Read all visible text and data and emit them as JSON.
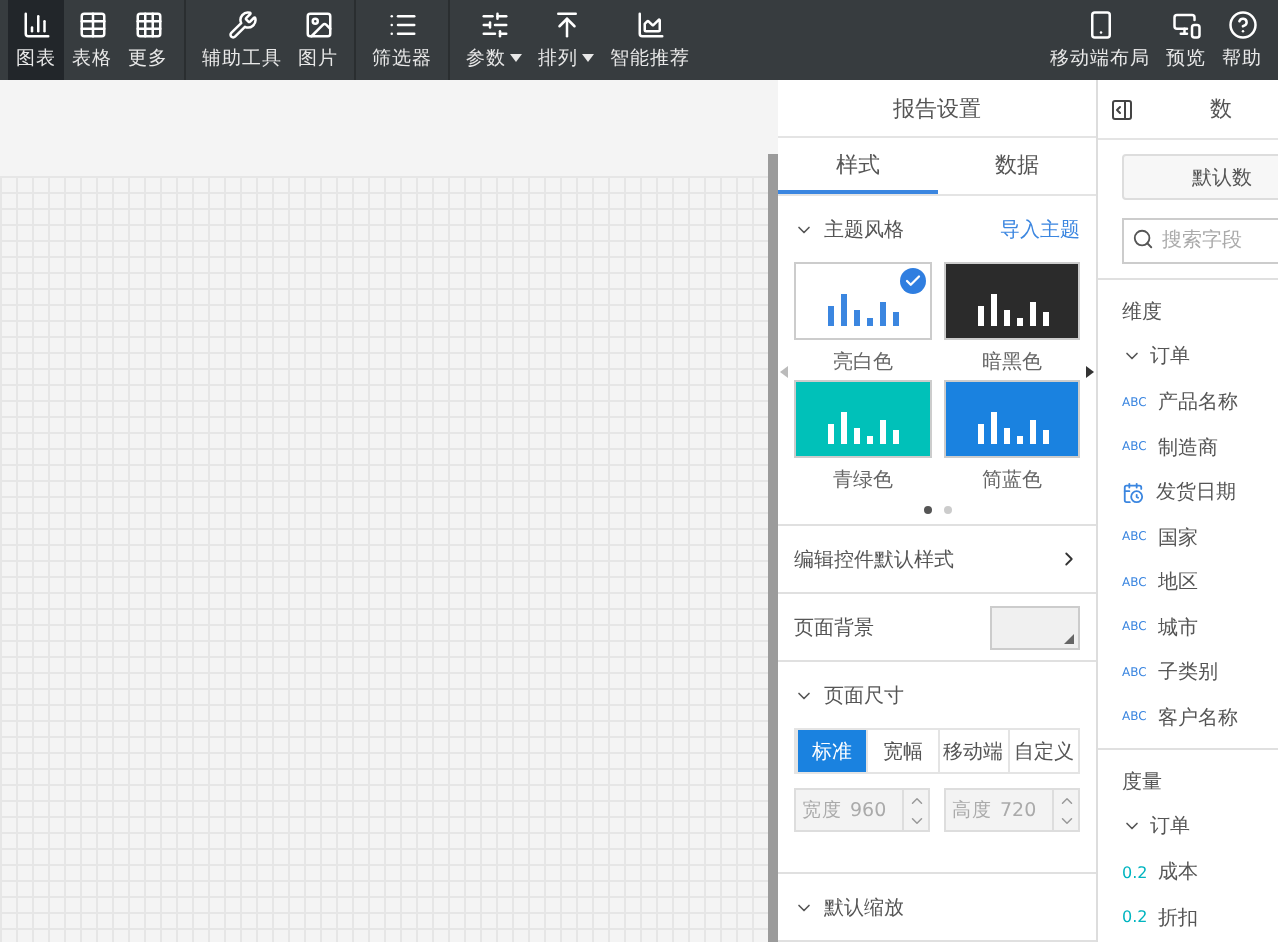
{
  "toolbar": {
    "groups": [
      [
        {
          "label": "图表",
          "selected": true,
          "menu": false
        },
        {
          "label": "表格",
          "selected": false,
          "menu": false
        },
        {
          "label": "更多",
          "selected": false,
          "menu": false
        }
      ],
      [
        {
          "label": "辅助工具",
          "selected": false,
          "menu": false
        },
        {
          "label": "图片",
          "selected": false,
          "menu": false
        }
      ],
      [
        {
          "label": "筛选器",
          "selected": false,
          "menu": false
        }
      ],
      [
        {
          "label": "参数",
          "selected": false,
          "menu": true
        },
        {
          "label": "排列",
          "selected": false,
          "menu": true
        },
        {
          "label": "智能推荐",
          "selected": false,
          "menu": false
        }
      ]
    ],
    "right": [
      {
        "label": "移动端布局"
      },
      {
        "label": "预览"
      },
      {
        "label": "帮助"
      }
    ]
  },
  "report_settings": {
    "title": "报告设置",
    "tabs": [
      {
        "label": "样式",
        "selected": true
      },
      {
        "label": "数据",
        "selected": false
      }
    ],
    "theme_section": {
      "title": "主题风格",
      "expanded": true,
      "link": "导入主题",
      "themes": [
        {
          "name": "亮白色",
          "color": "#ffffff",
          "selected": true
        },
        {
          "name": "暗黑色",
          "color": "#2b2b2b",
          "selected": false
        },
        {
          "name": "青绿色",
          "color": "#00c1b9",
          "selected": false
        },
        {
          "name": "简蓝色",
          "color": "#1a82e0",
          "selected": false
        }
      ],
      "pages": [
        {
          "selected": true
        },
        {
          "selected": false
        }
      ]
    },
    "edit_style": "编辑控件默认样式",
    "page_background": {
      "label": "页面背景"
    },
    "page_size": {
      "title": "页面尺寸",
      "expanded": true,
      "options": [
        {
          "label": "标准",
          "selected": true
        },
        {
          "label": "宽幅",
          "selected": false
        },
        {
          "label": "移动端",
          "selected": false
        },
        {
          "label": "自定义",
          "selected": false
        }
      ],
      "width": {
        "label": "宽度",
        "value": "960"
      },
      "height": {
        "label": "高度",
        "value": "720"
      }
    },
    "zoom_section": {
      "title": "默认缩放",
      "expanded": true
    }
  },
  "data_panel": {
    "title": "数",
    "button": "默认数",
    "search": {
      "placeholder": "搜索字段"
    },
    "dimensions": {
      "title": "维度",
      "table": "订单",
      "fields": [
        {
          "kind": "text",
          "badge": "ABC",
          "name": "产品名称"
        },
        {
          "kind": "text",
          "badge": "ABC",
          "name": "制造商"
        },
        {
          "kind": "date",
          "name": "发货日期"
        },
        {
          "kind": "text",
          "badge": "ABC",
          "name": "国家"
        },
        {
          "kind": "text",
          "badge": "ABC",
          "name": "地区"
        },
        {
          "kind": "text",
          "badge": "ABC",
          "name": "城市"
        },
        {
          "kind": "text",
          "badge": "ABC",
          "name": "子类别"
        },
        {
          "kind": "text",
          "badge": "ABC",
          "name": "客户名称"
        }
      ]
    },
    "measures": {
      "title": "度量",
      "table": "订单",
      "fields": [
        {
          "kind": "number",
          "badge": "0.2",
          "name": "成本"
        },
        {
          "kind": "number",
          "badge": "0.2",
          "name": "折扣"
        }
      ]
    }
  }
}
